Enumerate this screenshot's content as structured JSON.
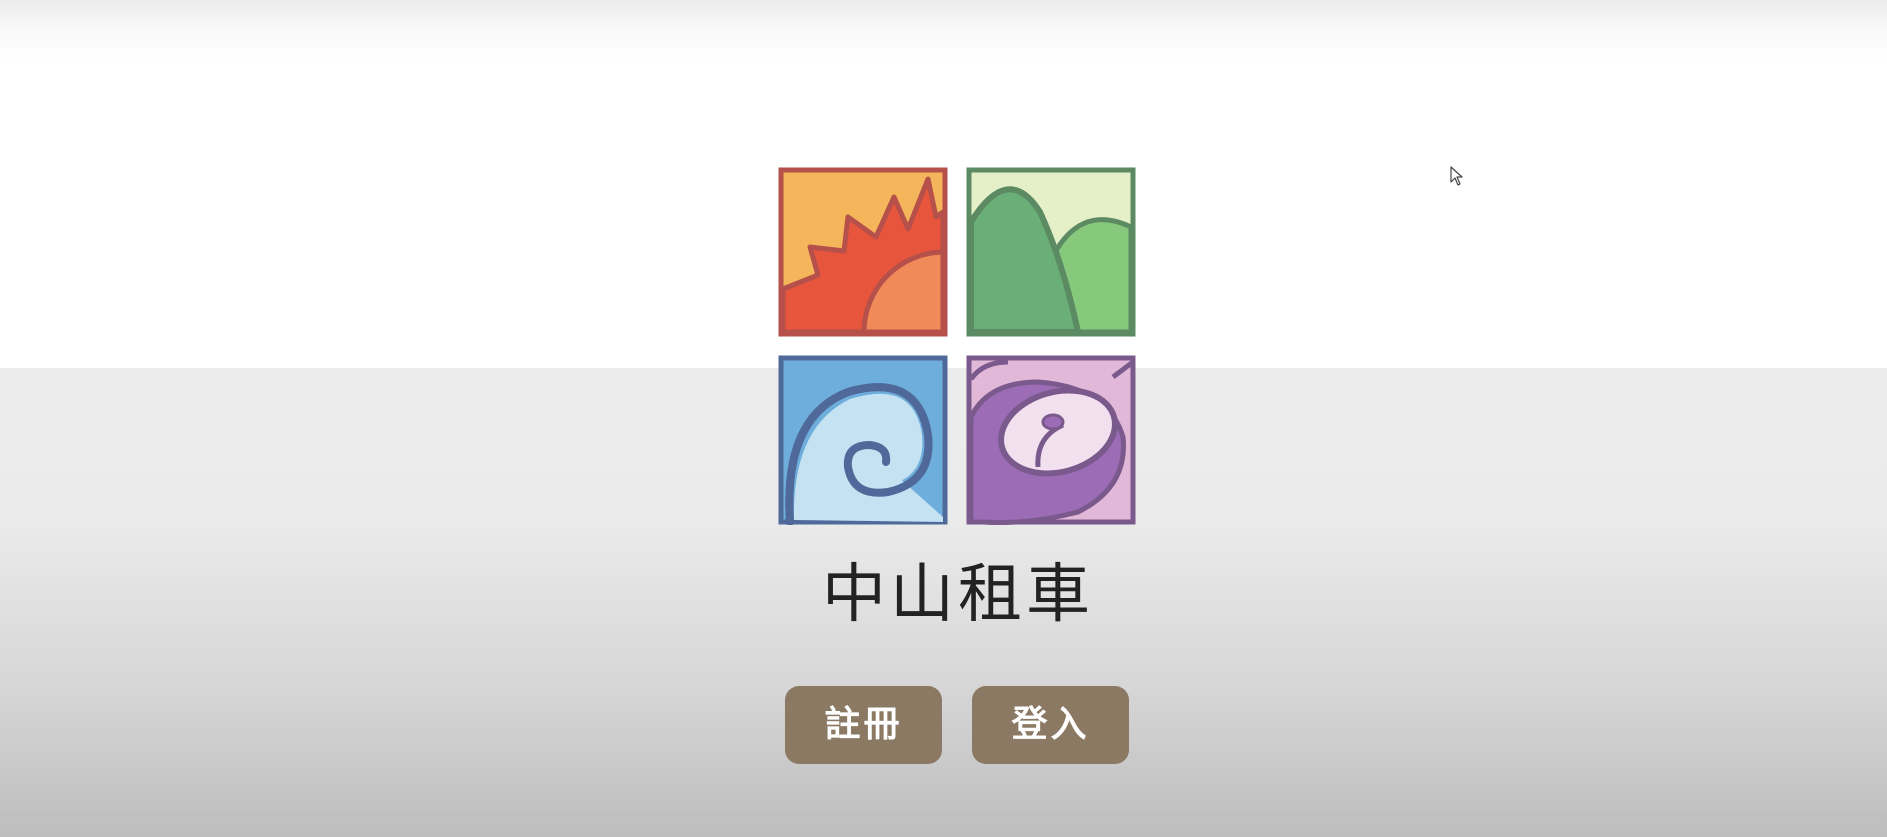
{
  "brand": {
    "name": "中山租車"
  },
  "logo": {
    "tiles": [
      {
        "icon": "sun-icon",
        "colors": {
          "sky": "#f5b55a",
          "rays": "#e8553d",
          "sun": "#f08a58",
          "border": "#b5504a"
        }
      },
      {
        "icon": "mountain-icon",
        "colors": {
          "sky": "#e6f0c8",
          "peak": "#6aaf78",
          "hill": "#86c97c",
          "border": "#5c8a62"
        }
      },
      {
        "icon": "wave-icon",
        "colors": {
          "bg": "#6eaedc",
          "wave": "#c4e2f2",
          "border": "#4f6a9a"
        }
      },
      {
        "icon": "flower-icon",
        "colors": {
          "bg": "#e2b8d8",
          "petal": "#9c6db6",
          "center": "#f3e0ee",
          "border": "#7a5a8c"
        }
      }
    ]
  },
  "actions": {
    "register_label": "註冊",
    "login_label": "登入"
  },
  "colors": {
    "button_bg": "#8b7963",
    "button_text": "#ffffff",
    "brand_text": "#222222"
  }
}
